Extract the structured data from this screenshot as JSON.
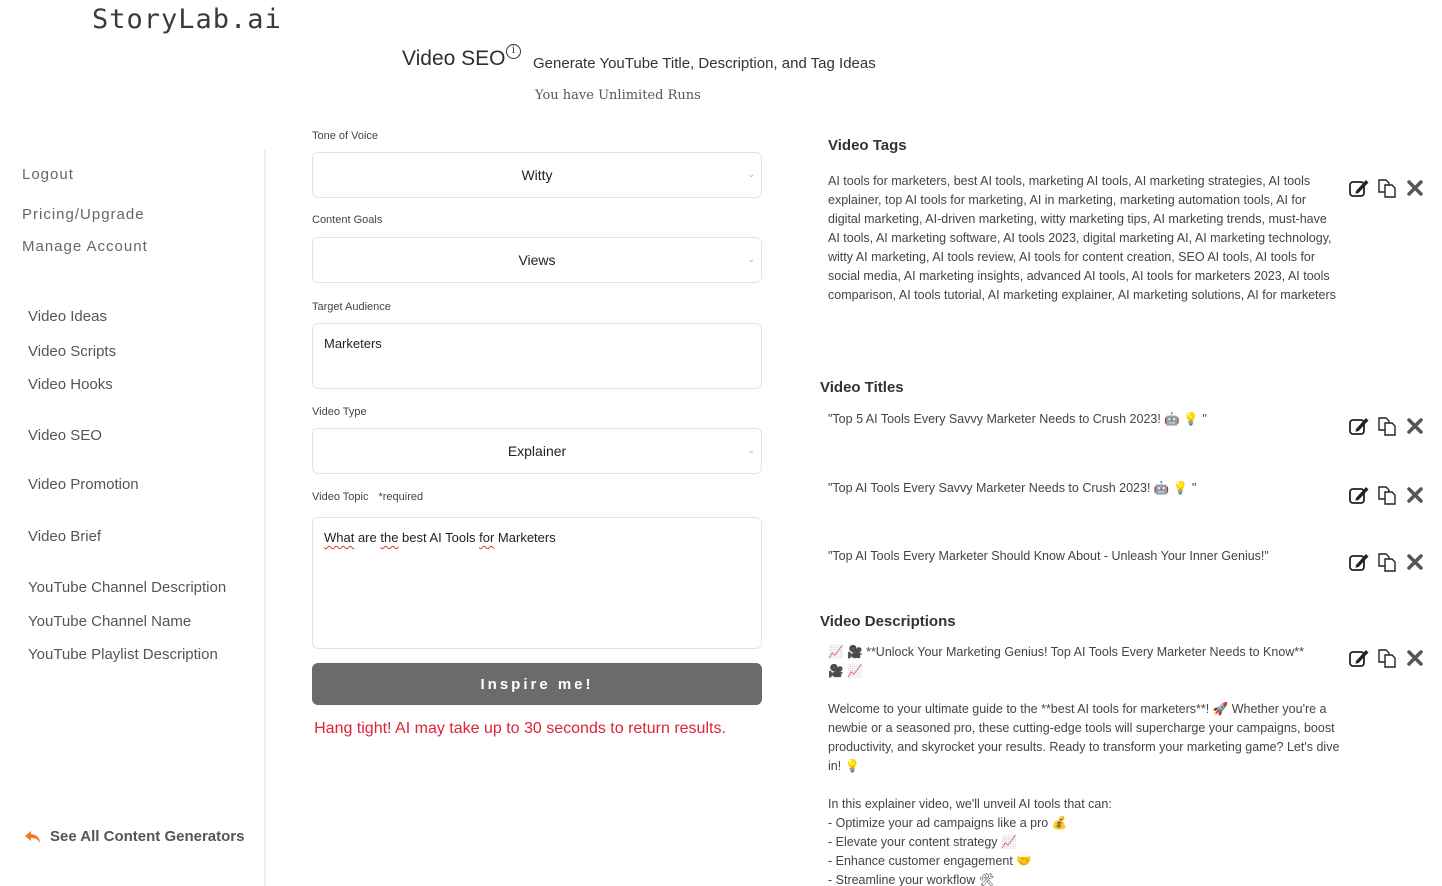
{
  "brand": {
    "logo": "StoryLab.ai"
  },
  "header": {
    "title": "Video SEO",
    "info_icon": "info-icon",
    "subtitle": "Generate YouTube Title, Description, and Tag Ideas",
    "runs": "You have Unlimited Runs"
  },
  "sidebar": {
    "account_links": [
      {
        "label": "Logout"
      },
      {
        "label": "Pricing/Upgrade"
      },
      {
        "label": "Manage Account"
      }
    ],
    "nav_items": [
      {
        "label": "Video Ideas"
      },
      {
        "label": "Video Scripts"
      },
      {
        "label": "Video Hooks"
      },
      {
        "label": "Video SEO"
      },
      {
        "label": "Video Promotion"
      },
      {
        "label": "Video Brief"
      },
      {
        "label": "YouTube Channel Description"
      },
      {
        "label": "YouTube Channel Name"
      },
      {
        "label": "YouTube Playlist Description"
      }
    ],
    "see_all": {
      "label": "See All Content Generators",
      "icon": "reply-arrow-icon"
    }
  },
  "form": {
    "tone": {
      "label": "Tone of Voice",
      "value": "Witty"
    },
    "goals": {
      "label": "Content Goals",
      "value": "Views"
    },
    "audience": {
      "label": "Target Audience",
      "value": "Marketers"
    },
    "video_type": {
      "label": "Video Type",
      "value": "Explainer"
    },
    "topic": {
      "label": "Video Topic",
      "required": "*required",
      "value_parts": [
        "What",
        " are ",
        "the",
        " best AI Tools ",
        "for",
        " Marketers"
      ]
    },
    "submit_label": "Inspire me!",
    "wait_message": "Hang tight! AI may take up to 30 seconds to return results."
  },
  "results": {
    "tags": {
      "title": "Video Tags",
      "text": "AI tools for marketers, best AI tools, marketing AI tools, AI marketing strategies, AI tools explainer, top AI tools for marketing, AI in marketing, marketing automation tools, AI for digital marketing, AI-driven marketing, witty marketing tips, AI marketing trends, must-have AI tools, AI marketing software, AI tools 2023, digital marketing AI, AI marketing technology, witty AI marketing, AI tools review, AI tools for content creation, SEO AI tools, AI tools for social media, AI marketing insights, advanced AI tools, AI tools for marketers 2023, AI tools comparison, AI tools tutorial, AI marketing explainer, AI marketing solutions, AI for marketers"
    },
    "titles": {
      "title": "Video Titles",
      "items": [
        {
          "text": "\"Top 5 AI Tools Every Savvy Marketer Needs to Crush 2023! 🤖 💡 \""
        },
        {
          "text": "\"Top AI Tools Every Savvy Marketer Needs to Crush 2023! 🤖 💡 \""
        },
        {
          "text": "\"Top AI Tools Every Marketer Should Know About - Unleash Your Inner Genius!\""
        }
      ]
    },
    "descriptions": {
      "title": "Video Descriptions",
      "paragraphs": [
        "📈 🎥 **Unlock Your Marketing Genius! Top AI Tools Every Marketer Needs to Know**\n🎥 📈",
        "Welcome to your ultimate guide to the **best AI tools for marketers**! 🚀 Whether you're a newbie or a seasoned pro, these cutting-edge tools will supercharge your campaigns, boost productivity, and skyrocket your results. Ready to transform your marketing game? Let's dive in! 💡",
        "In this explainer video, we'll unveil AI tools that can:\n- Optimize your ad campaigns like a pro 💰\n- Elevate your content strategy 📈\n- Enhance customer engagement 🤝\n- Streamline your workflow 🛠"
      ]
    },
    "actions": {
      "edit": "edit-icon",
      "copy": "copy-icon",
      "delete": "delete-icon"
    }
  },
  "colors": {
    "button_bg": "#6b6b6b",
    "warning_text": "#e0213a",
    "accent_arrow": "#f07c2a"
  }
}
